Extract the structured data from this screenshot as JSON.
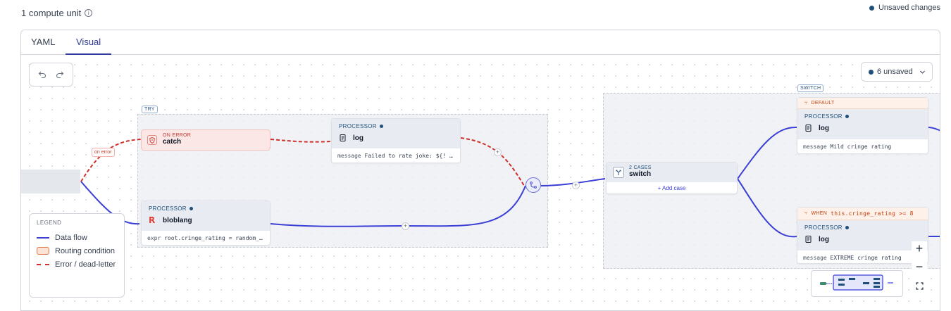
{
  "header": {
    "compute_units": "1 compute unit",
    "unsaved_status": "Unsaved changes"
  },
  "tabs": [
    {
      "label": "YAML",
      "active": false
    },
    {
      "label": "Visual",
      "active": true
    }
  ],
  "toolbar": {
    "unsaved_dropdown": "6 unsaved"
  },
  "groups": {
    "try_label": "TRY",
    "switch_label": "SWITCH"
  },
  "edges": {
    "on_error_label": "on error"
  },
  "nodes": {
    "catch": {
      "kind": "ON ERROR",
      "title": "catch"
    },
    "log_error": {
      "kind": "PROCESSOR",
      "title": "log",
      "field": "message",
      "value": "Failed to rate joke: ${! err…"
    },
    "bloblang": {
      "kind": "PROCESSOR",
      "title": "bloblang",
      "field": "expr",
      "value": "root.cringe_rating = random_int…"
    },
    "switch": {
      "kind": "2 CASES",
      "title": "switch",
      "add_case": "Add case"
    },
    "log_default": {
      "condition": "DEFAULT",
      "kind": "PROCESSOR",
      "title": "log",
      "field": "message",
      "value": "Mild cringe rating"
    },
    "log_when": {
      "condition_prefix": "WHEN",
      "condition": "this.cringe_rating >= 8",
      "kind": "PROCESSOR",
      "title": "log",
      "field": "message",
      "value": "EXTREME cringe rating"
    }
  },
  "legend": {
    "title": "LEGEND",
    "items": [
      "Data flow",
      "Routing condition",
      "Error / dead-letter"
    ]
  },
  "colors": {
    "accent": "#2e3a9a",
    "data_flow": "#3b3fd6",
    "error": "#d0302b",
    "status_dot": "#1e4f7a"
  }
}
